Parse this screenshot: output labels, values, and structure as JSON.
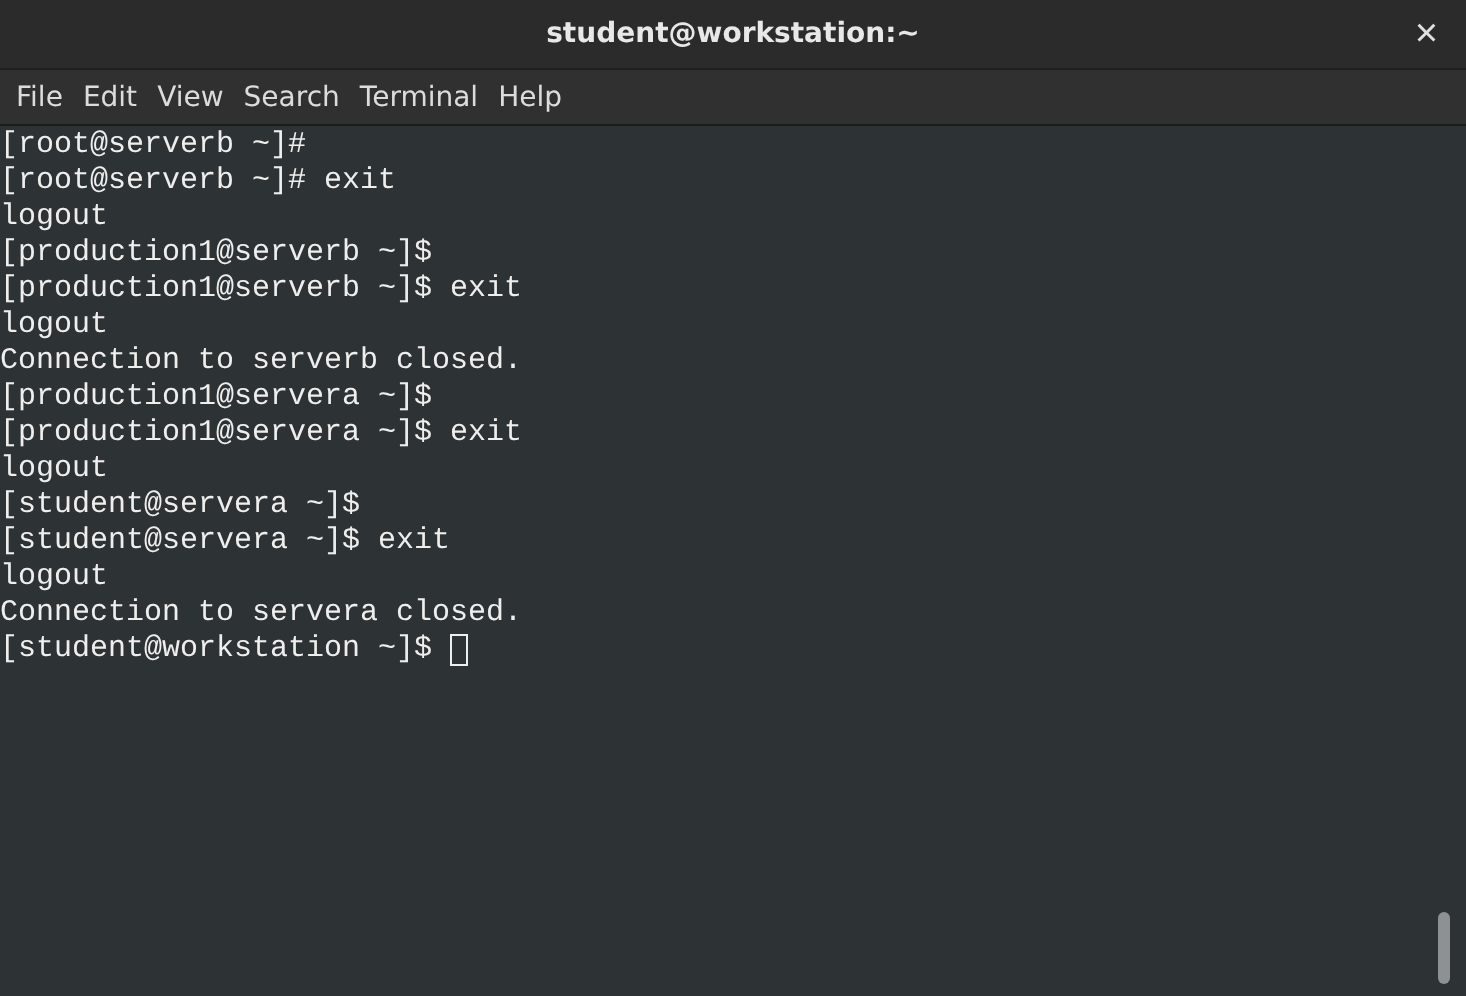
{
  "window": {
    "title": "student@workstation:~",
    "close": "×"
  },
  "menu": [
    "File",
    "Edit",
    "View",
    "Search",
    "Terminal",
    "Help"
  ],
  "terminal": {
    "lines": [
      {
        "text": "[root@serverb ~]#",
        "cursor": false
      },
      {
        "text": "[root@serverb ~]# exit",
        "cursor": false
      },
      {
        "text": "logout",
        "cursor": false
      },
      {
        "text": "[production1@serverb ~]$",
        "cursor": false
      },
      {
        "text": "[production1@serverb ~]$ exit",
        "cursor": false
      },
      {
        "text": "logout",
        "cursor": false
      },
      {
        "text": "Connection to serverb closed.",
        "cursor": false
      },
      {
        "text": "[production1@servera ~]$",
        "cursor": false
      },
      {
        "text": "[production1@servera ~]$ exit",
        "cursor": false
      },
      {
        "text": "logout",
        "cursor": false
      },
      {
        "text": "[student@servera ~]$",
        "cursor": false
      },
      {
        "text": "[student@servera ~]$ exit",
        "cursor": false
      },
      {
        "text": "logout",
        "cursor": false
      },
      {
        "text": "Connection to servera closed.",
        "cursor": false
      },
      {
        "text": "[student@workstation ~]$ ",
        "cursor": true
      }
    ]
  }
}
